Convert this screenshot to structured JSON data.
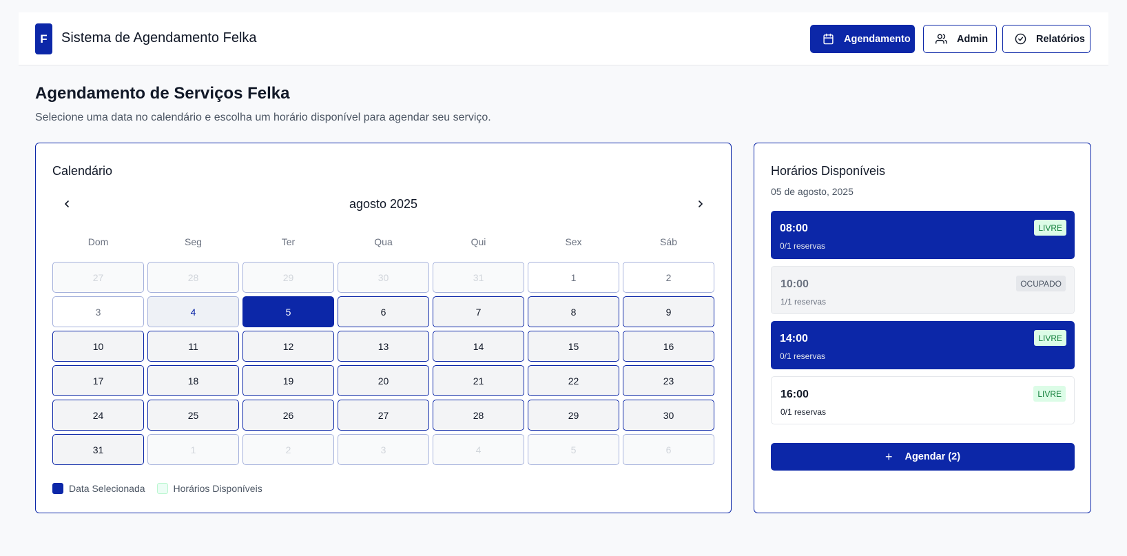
{
  "header": {
    "logo_letter": "F",
    "title": "Sistema de Agendamento Felka",
    "nav": [
      {
        "label": "Agendamento",
        "icon": "calendar-icon",
        "active": true
      },
      {
        "label": "Admin",
        "icon": "users-icon",
        "active": false
      },
      {
        "label": "Relatórios",
        "icon": "check-circle-icon",
        "active": false
      }
    ]
  },
  "page": {
    "title": "Agendamento de Serviços Felka",
    "subtitle": "Selecione uma data no calendário e escolha um horário disponível para agendar seu serviço."
  },
  "calendar": {
    "title": "Calendário",
    "month_label": "agosto 2025",
    "prev_icon": "chevron-left-icon",
    "next_icon": "chevron-right-icon",
    "weekdays": [
      "Dom",
      "Seg",
      "Ter",
      "Qua",
      "Qui",
      "Sex",
      "Sáb"
    ],
    "days": [
      {
        "label": "27",
        "state": "outside"
      },
      {
        "label": "28",
        "state": "outside"
      },
      {
        "label": "29",
        "state": "outside"
      },
      {
        "label": "30",
        "state": "outside"
      },
      {
        "label": "31",
        "state": "outside"
      },
      {
        "label": "1",
        "state": "past"
      },
      {
        "label": "2",
        "state": "past"
      },
      {
        "label": "3",
        "state": "past"
      },
      {
        "label": "4",
        "state": "today"
      },
      {
        "label": "5",
        "state": "selected"
      },
      {
        "label": "6",
        "state": "available"
      },
      {
        "label": "7",
        "state": "available"
      },
      {
        "label": "8",
        "state": "available"
      },
      {
        "label": "9",
        "state": "available"
      },
      {
        "label": "10",
        "state": "available"
      },
      {
        "label": "11",
        "state": "available"
      },
      {
        "label": "12",
        "state": "available"
      },
      {
        "label": "13",
        "state": "available"
      },
      {
        "label": "14",
        "state": "available"
      },
      {
        "label": "15",
        "state": "available"
      },
      {
        "label": "16",
        "state": "available"
      },
      {
        "label": "17",
        "state": "available"
      },
      {
        "label": "18",
        "state": "available"
      },
      {
        "label": "19",
        "state": "available"
      },
      {
        "label": "20",
        "state": "available"
      },
      {
        "label": "21",
        "state": "available"
      },
      {
        "label": "22",
        "state": "available"
      },
      {
        "label": "23",
        "state": "available"
      },
      {
        "label": "24",
        "state": "available"
      },
      {
        "label": "25",
        "state": "available"
      },
      {
        "label": "26",
        "state": "available"
      },
      {
        "label": "27",
        "state": "available"
      },
      {
        "label": "28",
        "state": "available"
      },
      {
        "label": "29",
        "state": "available"
      },
      {
        "label": "30",
        "state": "available"
      },
      {
        "label": "31",
        "state": "available"
      },
      {
        "label": "1",
        "state": "outside"
      },
      {
        "label": "2",
        "state": "outside"
      },
      {
        "label": "3",
        "state": "outside"
      },
      {
        "label": "4",
        "state": "outside"
      },
      {
        "label": "5",
        "state": "outside"
      },
      {
        "label": "6",
        "state": "outside"
      }
    ],
    "legend": {
      "selected": "Data Selecionada",
      "available": "Horários Disponíveis"
    }
  },
  "slots": {
    "title": "Horários Disponíveis",
    "date": "05 de agosto, 2025",
    "items": [
      {
        "time": "08:00",
        "reservations": "0/1 reservas",
        "status": "LIVRE",
        "state": "free-sel"
      },
      {
        "time": "10:00",
        "reservations": "1/1 reservas",
        "status": "OCUPADO",
        "state": "busy"
      },
      {
        "time": "14:00",
        "reservations": "0/1 reservas",
        "status": "LIVRE",
        "state": "free-sel"
      },
      {
        "time": "16:00",
        "reservations": "0/1 reservas",
        "status": "LIVRE",
        "state": "free"
      }
    ],
    "book_button": "Agendar (2)",
    "book_icon": "plus-icon"
  },
  "colors": {
    "primary": "#0c27a8",
    "free_badge_bg": "#dcfce7",
    "free_badge_text": "#15803d"
  }
}
